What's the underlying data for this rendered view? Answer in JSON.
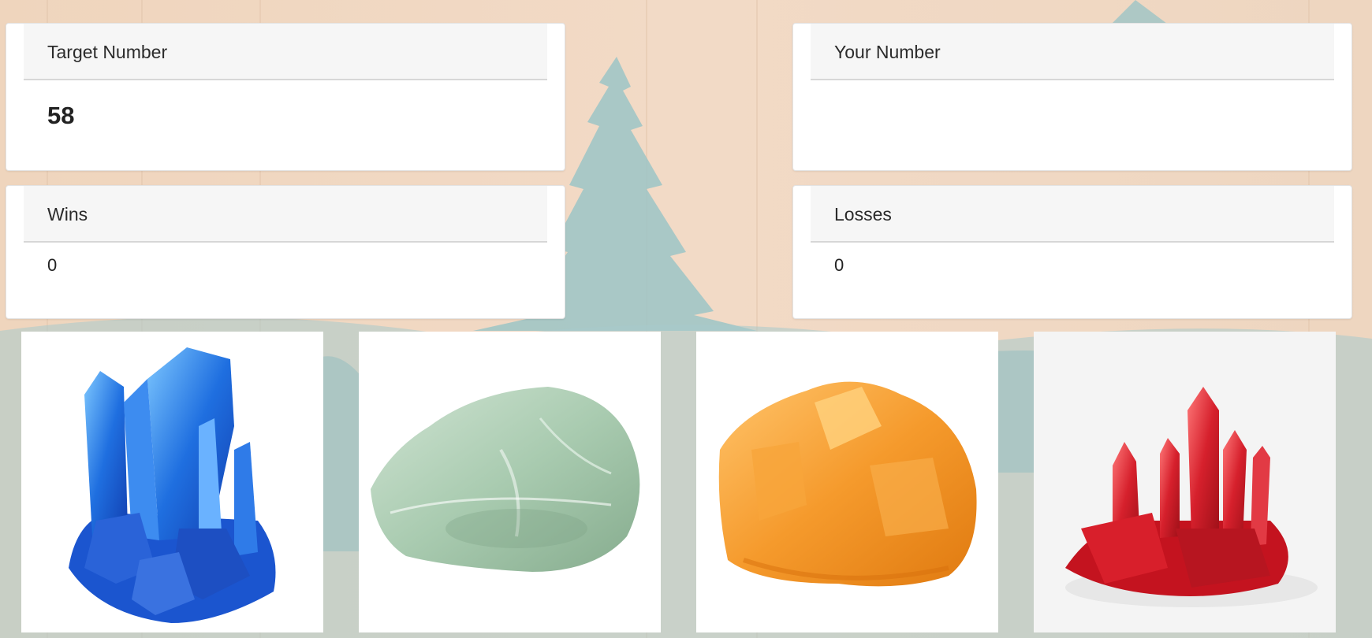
{
  "cards": {
    "target": {
      "header": "Target Number",
      "value": "58"
    },
    "yours": {
      "header": "Your Number",
      "value": ""
    },
    "wins": {
      "header": "Wins",
      "value": "0"
    },
    "losses": {
      "header": "Losses",
      "value": "0"
    }
  },
  "crystals": [
    {
      "icon": "blue-crystal-cluster-icon",
      "color": "#1f6fe0"
    },
    {
      "icon": "green-calcite-stone-icon",
      "color": "#a9cbb0"
    },
    {
      "icon": "orange-calcite-stone-icon",
      "color": "#f59a2c"
    },
    {
      "icon": "red-crystal-cluster-icon",
      "color": "#d6202c"
    }
  ],
  "colors": {
    "background": "#f1d9c4",
    "tree": "#8fbfc4",
    "card_header": "#f6f6f6"
  }
}
